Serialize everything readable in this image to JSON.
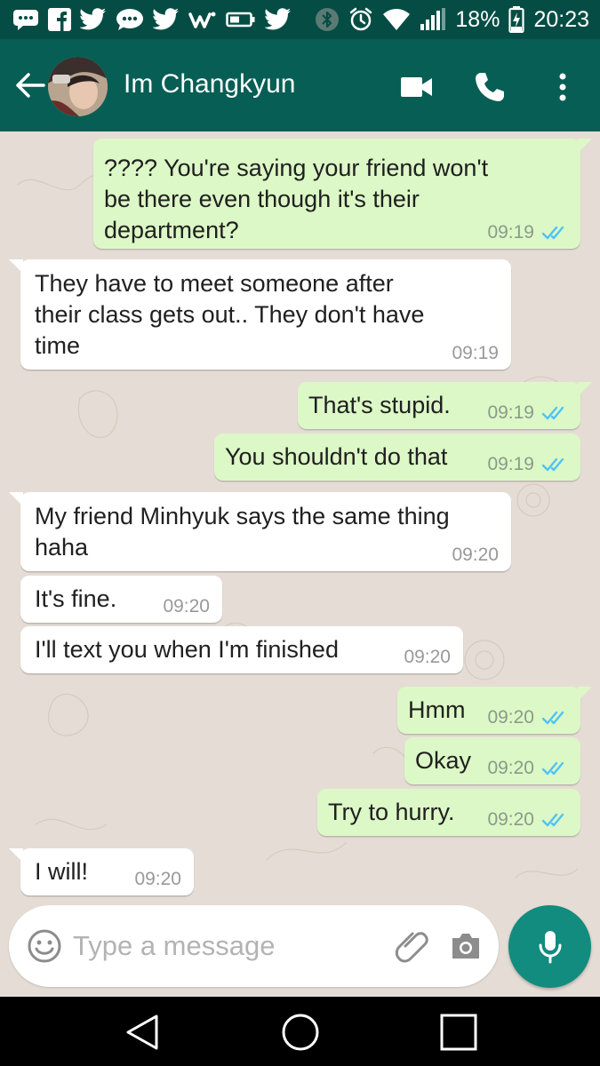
{
  "status_bar": {
    "battery": "18%",
    "time": "20:23"
  },
  "header": {
    "contact_name": "Im Changkyun"
  },
  "messages": [
    {
      "dir": "out",
      "lines": [
        "???? You're saying your friend won't",
        "be there even though it's their",
        "department?"
      ],
      "time": "09:19"
    },
    {
      "dir": "in",
      "lines": [
        "They have to meet someone after",
        "their class gets out.. They don't have",
        "time"
      ],
      "time": "09:19"
    },
    {
      "dir": "out",
      "lines": [
        "That's stupid."
      ],
      "time": "09:19"
    },
    {
      "dir": "out",
      "lines": [
        "You shouldn't do that"
      ],
      "time": "09:19"
    },
    {
      "dir": "in",
      "lines": [
        "My friend Minhyuk says the same thing",
        "haha"
      ],
      "time": "09:20"
    },
    {
      "dir": "in",
      "lines": [
        "It's fine."
      ],
      "time": "09:20"
    },
    {
      "dir": "in",
      "lines": [
        "I'll text you when I'm finished"
      ],
      "time": "09:20"
    },
    {
      "dir": "out",
      "lines": [
        "Hmm"
      ],
      "time": "09:20"
    },
    {
      "dir": "out",
      "lines": [
        "Okay"
      ],
      "time": "09:20"
    },
    {
      "dir": "out",
      "lines": [
        "Try to hurry."
      ],
      "time": "09:20"
    },
    {
      "dir": "in",
      "lines": [
        "I will!"
      ],
      "time": "09:20"
    }
  ],
  "composer": {
    "placeholder": "Type a message"
  },
  "colors": {
    "header": "#075e54",
    "status_bar": "#054d44",
    "outgoing_bubble": "#dcf8c6",
    "incoming_bubble": "#ffffff",
    "mic_button": "#128c7e",
    "read_ticks": "#4fc3f7"
  },
  "icons": {
    "status_left": [
      "chat-bubble-icon",
      "facebook-icon",
      "twitter-icon",
      "message-icon",
      "twitter-icon",
      "w-app-icon",
      "battery-saver-icon",
      "twitter-icon"
    ],
    "status_right": [
      "bluetooth-icon",
      "alarm-icon",
      "wifi-icon",
      "signal-icon",
      "battery-charging-icon"
    ]
  }
}
